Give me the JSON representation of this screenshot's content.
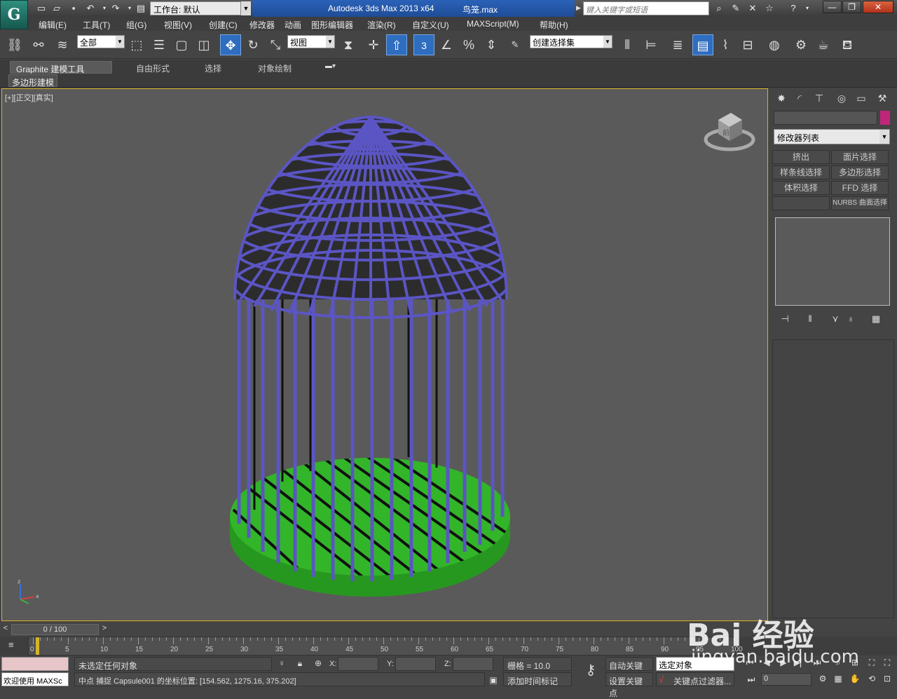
{
  "titlebar": {
    "workspace": "工作台: 默认",
    "app_title": "Autodesk 3ds Max  2013 x64",
    "document": "鸟笼.max",
    "search_placeholder": "键入关键字或短语"
  },
  "menu": [
    "编辑(E)",
    "工具(T)",
    "组(G)",
    "视图(V)",
    "创建(C)",
    "修改器",
    "动画",
    "图形编辑器",
    "渲染(R)",
    "自定义(U)",
    "MAXScript(M)",
    "帮助(H)"
  ],
  "toolbar": {
    "selection_filter": "全部",
    "ref_coord": "视图",
    "named_selection": "创建选择集",
    "snap_label": "3"
  },
  "ribbon": {
    "tabs": [
      "Graphite 建模工具",
      "自由形式",
      "选择",
      "对象绘制"
    ],
    "panel": "多边形建模"
  },
  "viewport": {
    "label": "[+][正交][真实]",
    "navcube_face": "前",
    "axis": {
      "x": "x",
      "y": "y",
      "z": "z"
    },
    "colors": {
      "cage": "#5b55c4",
      "base": "#33b52a",
      "background": "#5a5a5a"
    }
  },
  "command_panel": {
    "modifier_list": "修改器列表",
    "buttons": [
      "挤出",
      "面片选择",
      "样条线选择",
      "多边形选择",
      "体积选择",
      "FFD 选择",
      "",
      "NURBS 曲面选择"
    ],
    "color_swatch": "#c0267a"
  },
  "time": {
    "slider": "0 / 100",
    "ticks": [
      "0",
      "5",
      "10",
      "15",
      "20",
      "25",
      "30",
      "35",
      "40",
      "45",
      "50",
      "55",
      "60",
      "65",
      "70",
      "75",
      "80",
      "85",
      "90",
      "95",
      "100"
    ]
  },
  "status": {
    "welcome": "欢迎使用 MAXSc",
    "selection": "未选定任何对象",
    "prompt": "中点 捕捉 Capsule001 的坐标位置: [154.562, 1275.16, 375.202]",
    "x_label": "X:",
    "y_label": "Y:",
    "z_label": "Z:",
    "grid": "栅格 = 10.0",
    "add_time_tag": "添加时间标记",
    "auto_key": "自动关键点",
    "set_key": "设置关键点",
    "selected_object": "选定对象",
    "key_filter": "关键点过滤器...",
    "frame": "0"
  },
  "watermark": {
    "brand": "Bai 经验",
    "url": "jingyan.baidu.com"
  }
}
